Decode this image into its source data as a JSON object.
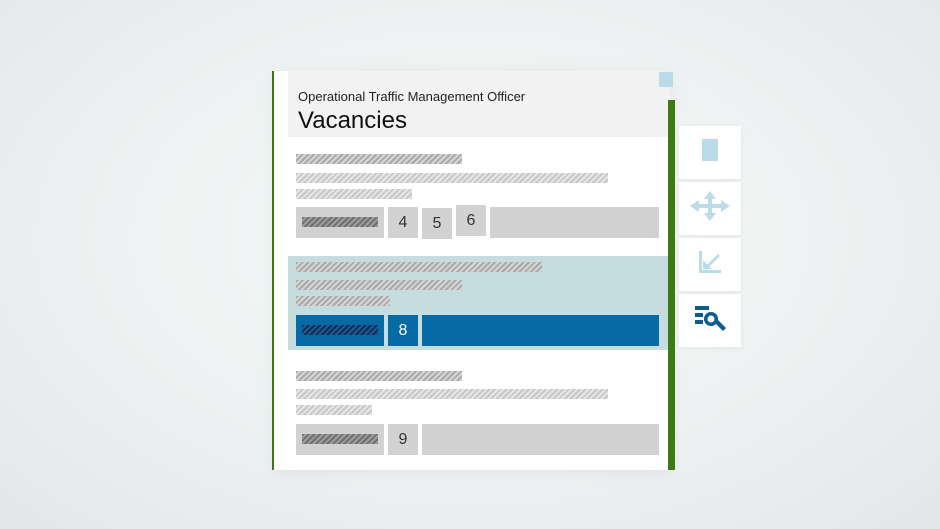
{
  "panel": {
    "subtitle": "Operational Traffic Management Officer",
    "title": "Vacancies"
  },
  "rows": [
    {
      "numbers": [
        "4",
        "5",
        "6"
      ],
      "selected": false
    },
    {
      "numbers": [
        "8"
      ],
      "selected": true
    },
    {
      "numbers": [
        "9"
      ],
      "selected": false
    }
  ],
  "toolbar": {
    "items": [
      {
        "icon": "document-icon"
      },
      {
        "icon": "move-arrows-icon"
      },
      {
        "icon": "resize-arrow-icon"
      },
      {
        "icon": "search-list-icon"
      }
    ]
  },
  "colors": {
    "accent_green": "#3e7a12",
    "selected_blue": "#066aa5",
    "selected_row_bg": "#c6dde0",
    "icon_light_blue": "#bcdbe8",
    "icon_dark_blue": "#0a5d8e"
  }
}
